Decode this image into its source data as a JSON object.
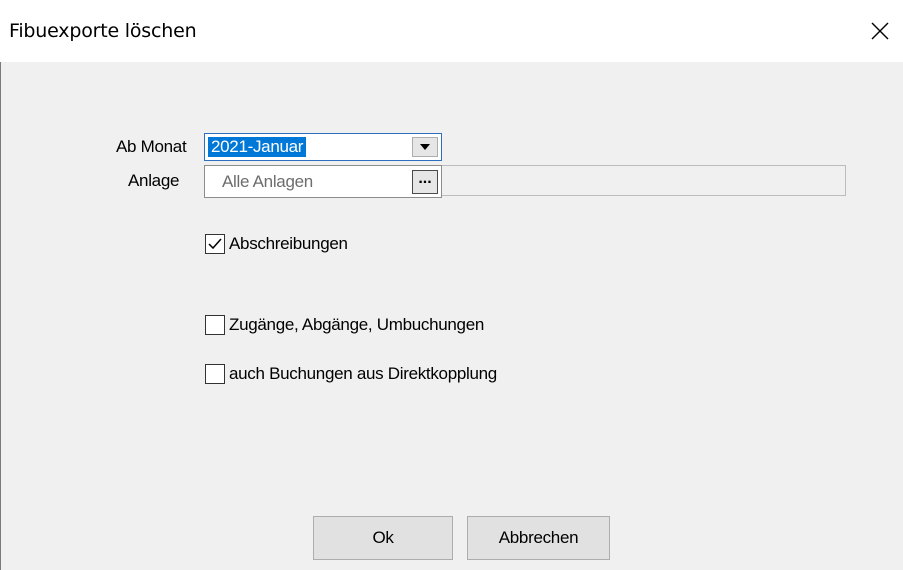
{
  "dialog": {
    "title": "Fibuexporte löschen",
    "close_icon": "close-icon"
  },
  "form": {
    "ab_monat_label": "Ab Monat",
    "ab_monat_value": "2021-Januar",
    "anlage_label": "Anlage",
    "anlage_value": "Alle Anlagen",
    "anlage_button_label": "..."
  },
  "options": [
    {
      "label": "Abschreibungen",
      "checked": true
    },
    {
      "label": "Zugänge, Abgänge, Umbuchungen",
      "checked": false
    },
    {
      "label": "auch Buchungen aus Direktkopplung",
      "checked": false
    }
  ],
  "buttons": {
    "ok_label": "Ok",
    "cancel_label": "Abbrechen"
  },
  "colors": {
    "selection": "#0078d7",
    "dialog_background": "#f0f0f0",
    "titlebar_background": "#ffffff"
  }
}
